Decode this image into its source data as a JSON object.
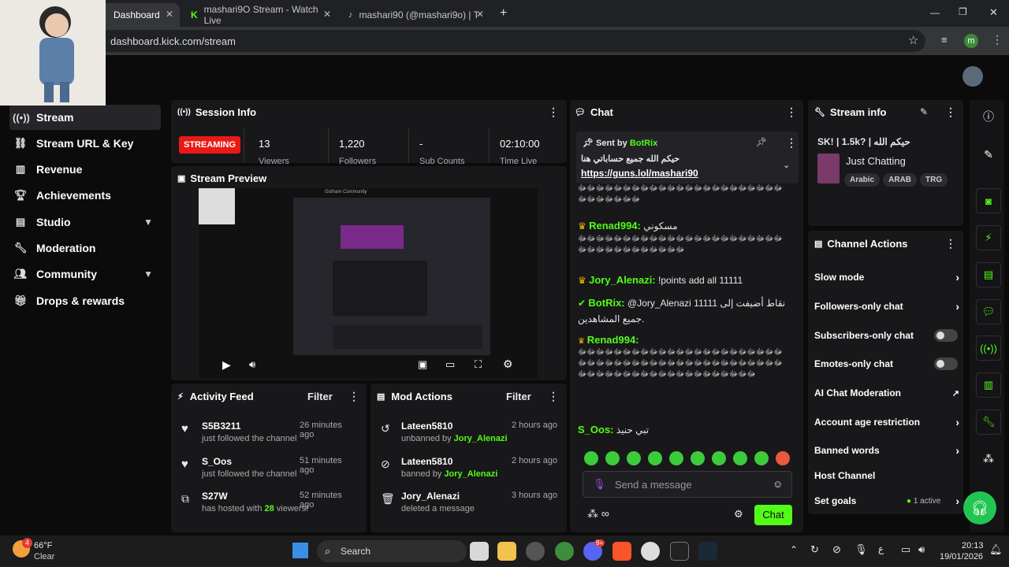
{
  "browser": {
    "tabs": [
      {
        "label": "Dashboard",
        "active": true
      },
      {
        "label": "mashari9O Stream - Watch Live",
        "active": false
      },
      {
        "label": "mashari90 (@mashari9o) | TikTo",
        "active": false
      }
    ],
    "url": "dashboard.kick.com/stream",
    "profile_initial": "m"
  },
  "sidebar": {
    "items": [
      {
        "label": "Stream",
        "icon": "broadcast-icon",
        "selected": true
      },
      {
        "label": "Stream URL & Key",
        "icon": "link-icon"
      },
      {
        "label": "Revenue",
        "icon": "chart-icon"
      },
      {
        "label": "Achievements",
        "icon": "trophy-icon"
      },
      {
        "label": "Studio",
        "icon": "studio-icon",
        "expandable": true
      },
      {
        "label": "Moderation",
        "icon": "wrench-icon"
      },
      {
        "label": "Community",
        "icon": "people-icon",
        "expandable": true
      },
      {
        "label": "Drops & rewards",
        "icon": "gift-icon"
      }
    ]
  },
  "session": {
    "title": "Session Info",
    "status": "STREAMING",
    "stats": [
      {
        "value": "13",
        "label": "Viewers"
      },
      {
        "value": "1,220",
        "label": "Followers"
      },
      {
        "value": "-",
        "label": "Sub Counts"
      },
      {
        "value": "02:10:00",
        "label": "Time Live"
      }
    ]
  },
  "preview": {
    "title": "Stream Preview",
    "mini_title": "Gotham Community"
  },
  "activity": {
    "title": "Activity Feed",
    "filter": "Filter",
    "items": [
      {
        "name": "S5B3211",
        "time": "26 minutes ago",
        "desc": "just followed the channel",
        "icon": "heart-icon"
      },
      {
        "name": "S_Oos",
        "time": "51 minutes ago",
        "desc": "just followed the channel",
        "icon": "heart-icon"
      },
      {
        "name": "S27W",
        "time": "52 minutes ago",
        "desc_pre": "has hosted with ",
        "desc_num": "28",
        "desc_post": " viewers!",
        "icon": "host-icon"
      }
    ]
  },
  "mod": {
    "title": "Mod Actions",
    "filter": "Filter",
    "items": [
      {
        "name": "Lateen5810",
        "time": "2 hours ago",
        "desc": "unbanned by ",
        "by": "Jory_Alenazi",
        "icon": "undo-icon"
      },
      {
        "name": "Lateen5810",
        "time": "2 hours ago",
        "desc": "banned by ",
        "by": "Jory_Alenazi",
        "icon": "ban-icon"
      },
      {
        "name": "Jory_Alenazi",
        "time": "3 hours ago",
        "desc": "deleted a message",
        "by": "",
        "icon": "trash-icon"
      }
    ]
  },
  "chat": {
    "title": "Chat",
    "pinned": {
      "sent_by": "Sent by",
      "sender": "BotRix",
      "text": "حيكم الله جميع حساباتي هنا",
      "link": "https://guns.lol/mashari90"
    },
    "messages": [
      {
        "user": "",
        "text": "ﷻﷻﷻﷻﷻﷻﷻﷻﷻﷻﷻﷻﷻﷻﷻﷻﷻﷻﷻﷻﷻﷻﷻﷻﷻﷻﷻﷻﷻﷻ"
      },
      {
        "user": "Renad994:",
        "color": "#53fc18",
        "text": "مسكوني"
      },
      {
        "user": "",
        "text": "ﷻﷻﷻﷻﷻﷻﷻﷻﷻﷻﷻﷻﷻﷻﷻﷻﷻﷻﷻﷻﷻﷻﷻﷻﷻﷻﷻﷻﷻﷻﷻﷻﷻﷻﷻ"
      },
      {
        "user": "Jory_Alenazi:",
        "color": "#53fc18",
        "text": "!points add all 11111"
      },
      {
        "user": "BotRix:",
        "color": "#53fc18",
        "text": "@Jory_Alenazi 11111 نقاط أضيفت إلى جميع المشاهدين."
      },
      {
        "user": "Renad994:",
        "color": "#53fc18",
        "text": "ﷻﷻﷻﷻﷻﷻﷻﷻﷻﷻﷻﷻﷻﷻﷻﷻﷻﷻﷻﷻﷻﷻﷻﷻﷻﷻﷻﷻﷻﷻﷻﷻﷻﷻﷻﷻﷻﷻﷻﷻﷻﷻﷻﷻﷻﷻﷻﷻﷻﷻﷻﷻﷻﷻﷻﷻﷻﷻﷻﷻﷻﷻﷻﷻﷻﷻ"
      },
      {
        "user": "S_Oos:",
        "color": "#53fc18",
        "text": "تبي حنيذ"
      }
    ],
    "input_placeholder": "Send a message",
    "send_label": "Chat"
  },
  "stream_info": {
    "title": "Stream info",
    "stream_title": "SK! | 1.5k? | حيكم الله",
    "category": "Just Chatting",
    "tags": [
      "Arabic",
      "ARAB",
      "TRG"
    ]
  },
  "channel_actions": {
    "title": "Channel Actions",
    "items": [
      {
        "label": "Slow mode",
        "control": "chevron"
      },
      {
        "label": "Followers-only chat",
        "control": "chevron"
      },
      {
        "label": "Subscribers-only chat",
        "control": "toggle"
      },
      {
        "label": "Emotes-only chat",
        "control": "toggle"
      },
      {
        "label": "AI Chat Moderation",
        "control": "external"
      },
      {
        "label": "Account age restriction",
        "control": "chevron"
      },
      {
        "label": "Banned words",
        "control": "chevron"
      },
      {
        "label": "Host Channel",
        "control": "none"
      },
      {
        "label": "Set goals",
        "control": "chevron",
        "extra": "1 active"
      }
    ]
  },
  "taskbar": {
    "weather_temp": "66°F",
    "weather_desc": "Clear",
    "weather_badge": "4",
    "search": "Search",
    "time": "20:13",
    "date": "19/01/2026",
    "lang": "ع",
    "discord_badge": "9+"
  },
  "colors": {
    "accent": "#53fc18",
    "streaming": "#e91916",
    "panel": "#18181b"
  }
}
